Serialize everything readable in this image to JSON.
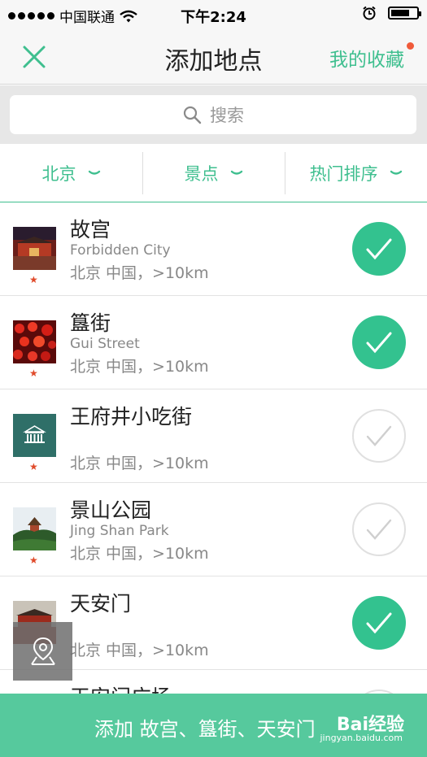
{
  "status_bar": {
    "carrier": "中国联通",
    "time": "下午2:24"
  },
  "nav": {
    "title": "添加地点",
    "favorites_label": "我的收藏"
  },
  "search": {
    "placeholder": "搜索"
  },
  "filters": [
    {
      "label": "北京"
    },
    {
      "label": "景点"
    },
    {
      "label": "热门排序"
    }
  ],
  "places": [
    {
      "name": "故宫",
      "english": " Forbidden City",
      "location": "北京 中国，>10km",
      "selected": true
    },
    {
      "name": "簋街",
      "english": "Gui Street",
      "location": "北京 中国，>10km",
      "selected": true
    },
    {
      "name": "王府井小吃街",
      "english": "",
      "location": "北京 中国，>10km",
      "selected": false
    },
    {
      "name": "景山公园",
      "english": "Jing Shan Park",
      "location": "北京 中国，>10km",
      "selected": false
    },
    {
      "name": "天安门",
      "english": "",
      "location": "北京 中国，>10km",
      "selected": true
    },
    {
      "name": "天安门广场",
      "english": "",
      "location": "",
      "selected": false
    }
  ],
  "bottom_bar": {
    "text": "添加 故宫、簋街、天安门"
  },
  "watermark": {
    "brand": "Bai经验",
    "url": "jingyan.baidu.com"
  },
  "colors": {
    "accent": "#3fbf8f",
    "check_on": "#33c28f",
    "bottom": "#56c99d",
    "star": "#e04a2a"
  }
}
